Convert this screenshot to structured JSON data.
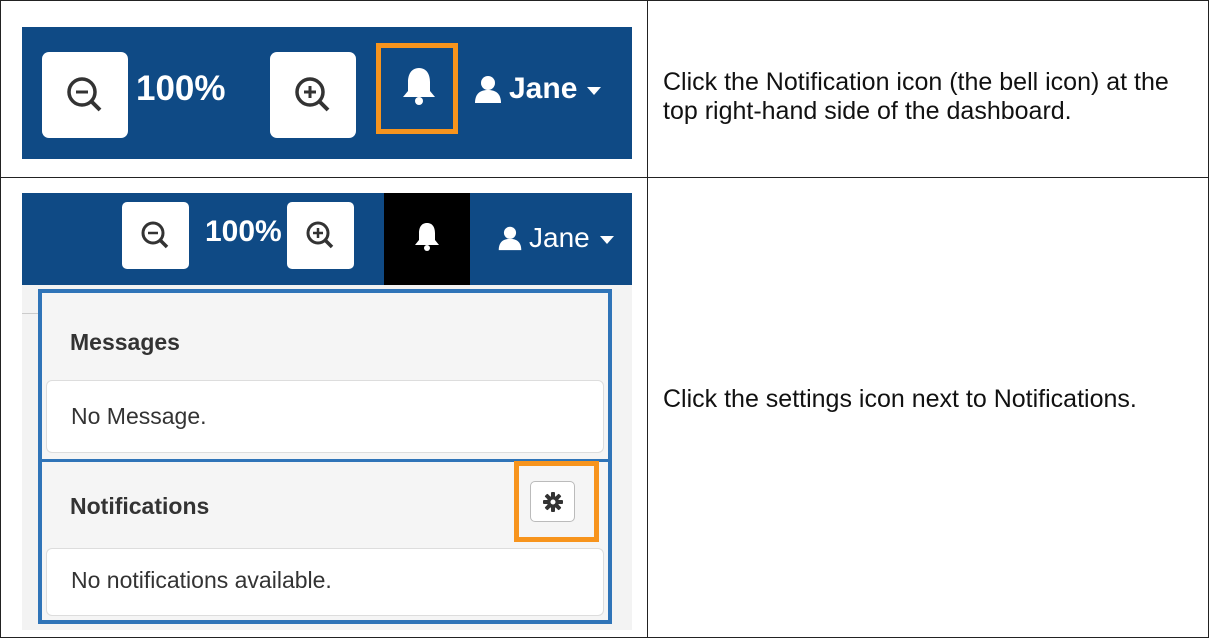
{
  "rows": [
    {
      "instruction": "Click the Notification icon (the bell icon) at the top right-hand side of the dashboard.",
      "toolbar": {
        "zoom_level": "100%",
        "user_name": "Jane"
      }
    },
    {
      "instruction": "Click the settings icon next to Notifications.",
      "toolbar": {
        "zoom_level": "100%",
        "user_name": "Jane"
      },
      "panel": {
        "messages_title": "Messages",
        "messages_empty": "No Message.",
        "notifications_title": "Notifications",
        "notifications_empty": "No notifications available."
      }
    }
  ],
  "colors": {
    "toolbar_bg": "#0f4a85",
    "highlight": "#f7941d",
    "panel_border": "#2f74b8"
  }
}
